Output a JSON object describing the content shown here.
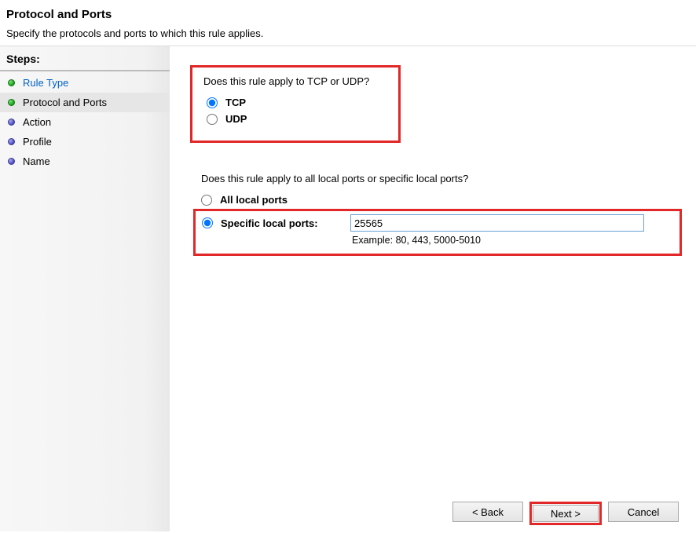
{
  "header": {
    "title": "Protocol and Ports",
    "subtitle": "Specify the protocols and ports to which this rule applies."
  },
  "sidebar": {
    "title": "Steps:",
    "items": [
      {
        "label": "Rule Type",
        "bullet": "green",
        "link": true,
        "current": false
      },
      {
        "label": "Protocol and Ports",
        "bullet": "green",
        "link": false,
        "current": true
      },
      {
        "label": "Action",
        "bullet": "purple",
        "link": false,
        "current": false
      },
      {
        "label": "Profile",
        "bullet": "purple",
        "link": false,
        "current": false
      },
      {
        "label": "Name",
        "bullet": "purple",
        "link": false,
        "current": false
      }
    ]
  },
  "main": {
    "protocol_question": "Does this rule apply to TCP or UDP?",
    "tcp_label": "TCP",
    "udp_label": "UDP",
    "ports_question": "Does this rule apply to all local ports or specific local ports?",
    "all_ports_label": "All local ports",
    "specific_label": "Specific local ports:",
    "port_value": "25565",
    "example_text": "Example: 80, 443, 5000-5010"
  },
  "buttons": {
    "back": "< Back",
    "next": "Next >",
    "cancel": "Cancel"
  }
}
